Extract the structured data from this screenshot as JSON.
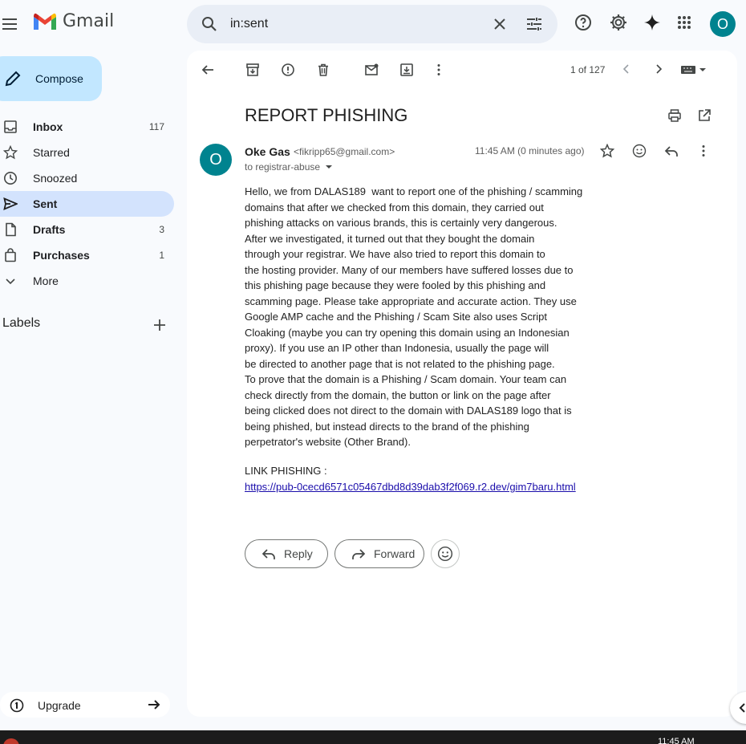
{
  "app": {
    "name": "Gmail"
  },
  "search": {
    "query": "in:sent"
  },
  "sidebar": {
    "compose_label": "Compose",
    "items": [
      {
        "label": "Inbox",
        "count": "117",
        "icon": "inbox-icon",
        "bold": true
      },
      {
        "label": "Starred",
        "count": "",
        "icon": "star-icon",
        "bold": false
      },
      {
        "label": "Snoozed",
        "count": "",
        "icon": "clock-icon",
        "bold": false
      },
      {
        "label": "Sent",
        "count": "",
        "icon": "send-icon",
        "bold": true,
        "active": true
      },
      {
        "label": "Drafts",
        "count": "3",
        "icon": "draft-icon",
        "bold": true
      },
      {
        "label": "Purchases",
        "count": "1",
        "icon": "shopping-bag-icon",
        "bold": true
      },
      {
        "label": "More",
        "count": "",
        "icon": "chevron-down-icon",
        "bold": false
      }
    ],
    "labels_heading": "Labels",
    "upgrade_label": "Upgrade"
  },
  "toolbar": {
    "pager": "1 of 127"
  },
  "message": {
    "subject": "REPORT PHISHING",
    "sender_name": "Oke Gas",
    "sender_email": "<fikripp65@gmail.com>",
    "to": "to registrar-abuse",
    "time": "11:45 AM (0 minutes ago)",
    "avatar_letter": "O",
    "body_lines": [
      "Hello, we from DALAS189  want to report one of the phishing / scamming",
      "domains that after we checked from this domain, they carried out",
      "phishing attacks on various brands, this is certainly very dangerous.",
      "After we investigated, it turned out that they bought the domain",
      "through your registrar. We have also tried to report this domain to",
      "the hosting provider. Many of our members have suffered losses due to",
      "this phishing page because they were fooled by this phishing and",
      "scamming page. Please take appropriate and accurate action. They use",
      "Google AMP cache and the Phishing / Scam Site also uses Script",
      "Cloaking (maybe you can try opening this domain using an Indonesian",
      "proxy). If you use an IP other than Indonesia, usually the page will",
      "be directed to another page that is not related to the phishing page.",
      "To prove that the domain is a Phishing / Scam domain. Your team can",
      "check directly from the domain, the button or link on the page after",
      "being clicked does not direct to the domain with DALAS189 logo that is",
      "being phished, but instead directs to the brand of the phishing",
      "perpetrator's website (Other Brand)."
    ],
    "link_label": "LINK PHISHING :",
    "link_url": "https://pub-0cecd6571c05467dbd8d39dab3f2f069.r2.dev/gim7baru.html"
  },
  "actions": {
    "reply": "Reply",
    "forward": "Forward"
  },
  "profile": {
    "letter": "O"
  },
  "taskbar": {
    "time": "11:45 AM"
  },
  "colors": {
    "accent": "#0b57d0",
    "compose": "#c2e7ff",
    "active_nav": "#d3e3fd",
    "avatar": "#00838f"
  }
}
